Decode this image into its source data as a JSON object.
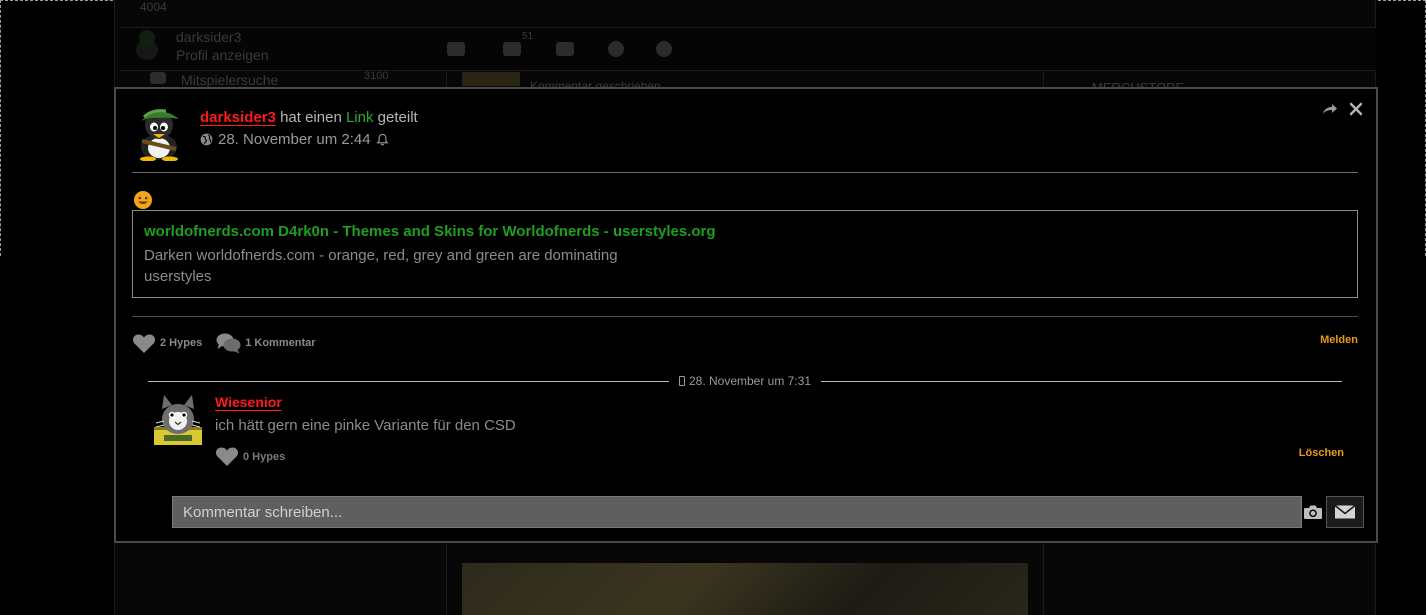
{
  "background_page": {
    "top_label": "4004",
    "user_name": "darksider3",
    "user_link": "Profil anzeigen",
    "sidebar_item": "Mitspielersuche",
    "sidebar_count": "3100",
    "nav_count": "51",
    "right_heading": "MERCHSTORE",
    "feed_item": "Kommentar geschrieben"
  },
  "post": {
    "author": "darksider3",
    "action_pre": "hat einen",
    "action_link": "Link",
    "action_post": "geteilt",
    "timestamp": "28. November um 2:44",
    "link_card": {
      "title": "worldofnerds.com D4rk0n - Themes and Skins for Worldofnerds - userstyles.org",
      "description": "Darken worldofnerds.com - orange, red, grey and green are dominating",
      "source": "userstyles"
    },
    "hypes_label": "2 Hypes",
    "comments_label": "1 Kommentar",
    "report_label": "Melden"
  },
  "comment": {
    "timestamp": "28. November um 7:31",
    "author": "Wiesenior",
    "text": "ich hätt gern eine pinke Variante für den CSD",
    "hypes_label": "0 Hypes",
    "delete_label": "Löschen"
  },
  "composer": {
    "placeholder": "Kommentar schreiben..."
  },
  "colors": {
    "author_red": "#ff1a1a",
    "link_green": "#1f9e1f",
    "action_orange": "#e89a16",
    "input_bg": "#5f5f5f"
  },
  "icons": [
    "share-icon",
    "close-icon",
    "globe-icon",
    "bell-icon",
    "smiley-emoji",
    "heart-icon",
    "comment-icon",
    "phone-icon",
    "camera-icon",
    "mail-icon"
  ]
}
